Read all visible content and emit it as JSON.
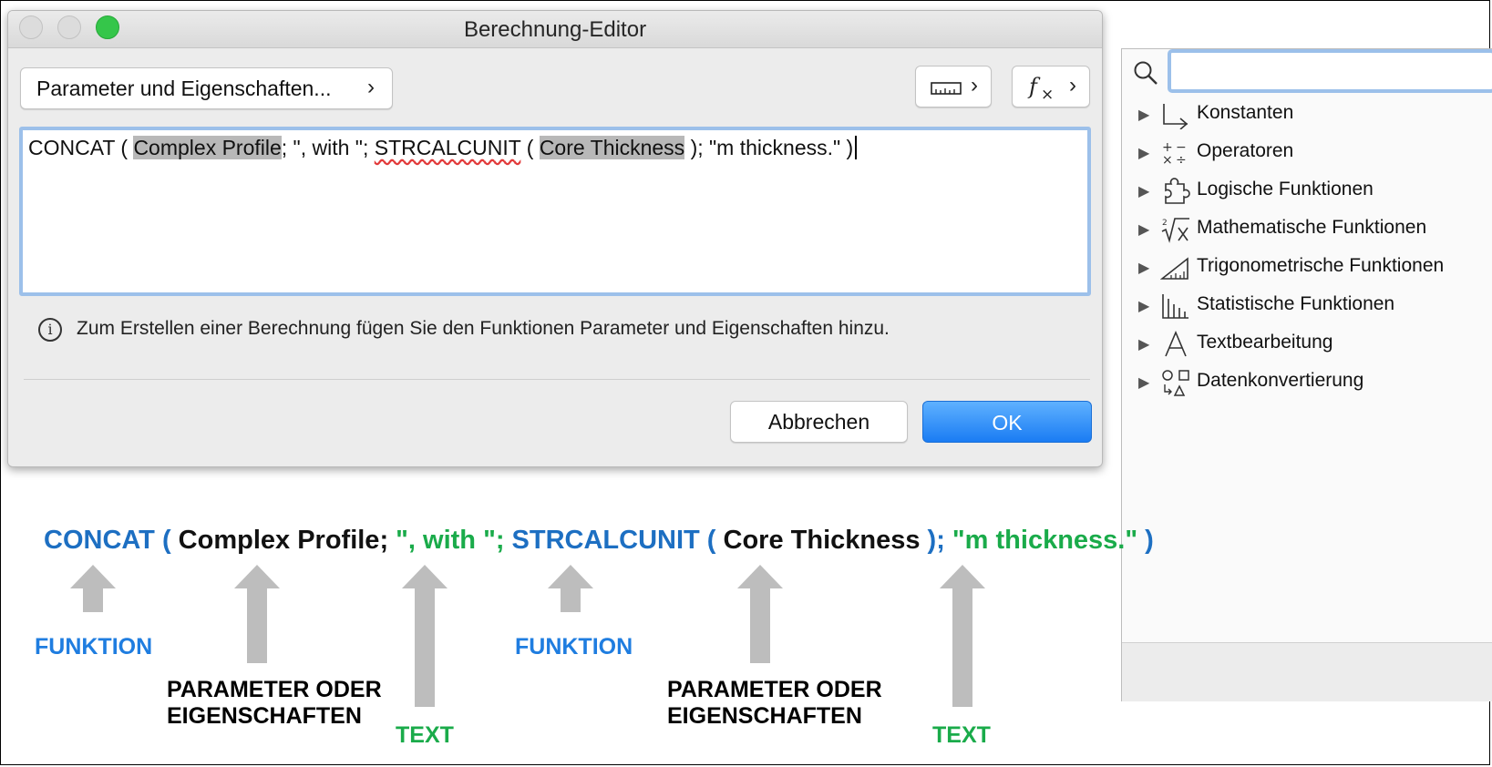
{
  "dialog": {
    "title": "Berechnung-Editor",
    "param_button_label": "Parameter und Eigenschaften...",
    "formula": {
      "p1": "CONCAT ( ",
      "param1": "Complex Profile",
      "p2": "; \", with \"; ",
      "func2": "STRCALCUNIT",
      "p3": " ( ",
      "param2": "Core Thickness",
      "p4": " ); \"m thickness.\" )"
    },
    "info_text": "Zum Erstellen einer Berechnung fügen Sie den Funktionen Parameter und  Eigenschaften hinzu.",
    "cancel_label": "Abbrechen",
    "ok_label": "OK"
  },
  "panel": {
    "search_value": "",
    "items": [
      {
        "label": "Konstanten",
        "icon": "constants-icon"
      },
      {
        "label": "Operatoren",
        "icon": "operators-icon"
      },
      {
        "label": "Logische Funktionen",
        "icon": "puzzle-icon"
      },
      {
        "label": "Mathematische Funktionen",
        "icon": "root-icon"
      },
      {
        "label": "Trigonometrische Funktionen",
        "icon": "triangle-ruler-icon"
      },
      {
        "label": "Statistische Funktionen",
        "icon": "bar-chart-icon"
      },
      {
        "label": "Textbearbeitung",
        "icon": "letter-a-icon"
      },
      {
        "label": "Datenkonvertierung",
        "icon": "convert-shapes-icon"
      }
    ]
  },
  "annotation": {
    "formula": {
      "s1": "CONCAT (",
      "s2": " Complex Profile;",
      "s3": " \", with \";",
      "s4": " STRCALCUNIT (",
      "s5": " Core Thickness",
      "s6": " );",
      "s7": " \"m thickness.\"",
      "s8": " )"
    },
    "labels": {
      "funktion1": "FUNKTION",
      "param1_line1": "PARAMETER ODER",
      "param1_line2": "EIGENSCHAFTEN",
      "text1": "TEXT",
      "funktion2": "FUNKTION",
      "param2_line1": "PARAMETER ODER",
      "param2_line2": "EIGENSCHAFTEN",
      "text2": "TEXT"
    },
    "colors": {
      "function": "#1d6fc2",
      "text": "#1aab4a",
      "label_function": "#1f7de0",
      "arrow": "#bdbdbd"
    }
  }
}
